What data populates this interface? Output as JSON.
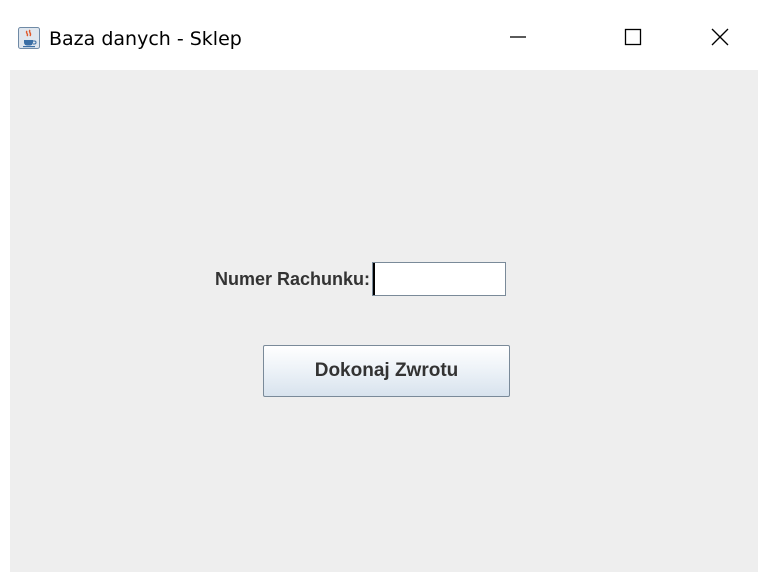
{
  "window": {
    "title": "Baza danych - Sklep",
    "icon": "java-coffee-cup-icon",
    "controls": {
      "minimize_icon": "minimize-icon",
      "maximize_icon": "maximize-icon",
      "close_icon": "close-icon"
    }
  },
  "form": {
    "receipt_label": "Numer Rachunku:",
    "receipt_value": "",
    "return_button_label": "Dokonaj Zwrotu"
  },
  "colors": {
    "content_background": "#eeeeee",
    "titlebar_background": "#ffffff",
    "label_text": "#333333",
    "input_border": "#7a8a99"
  }
}
